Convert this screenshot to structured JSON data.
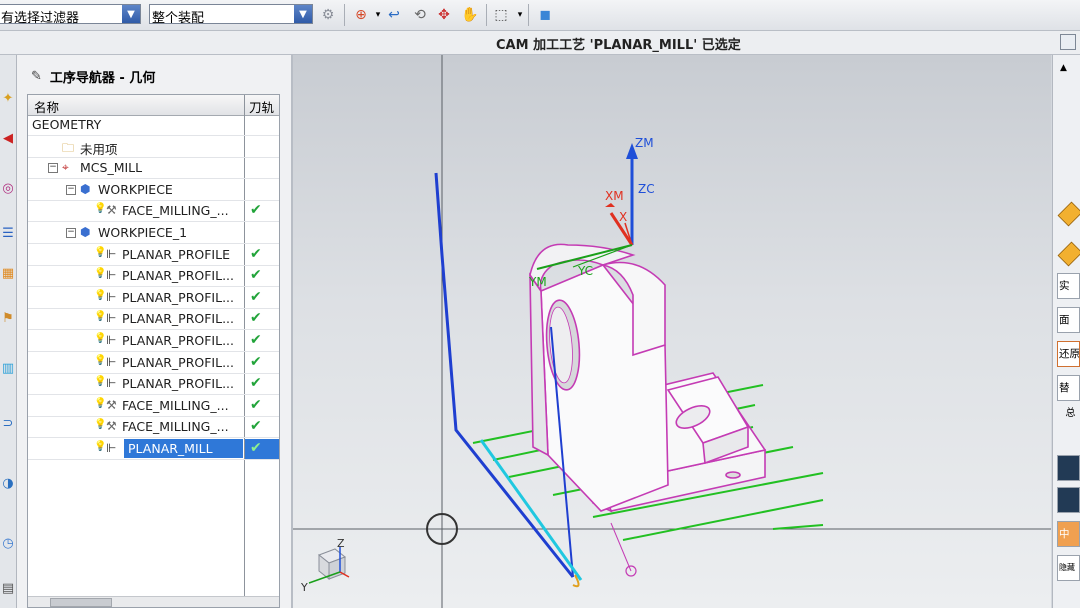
{
  "toolbar": {
    "filter_combo": "有选择过滤器",
    "scope_combo": "整个装配"
  },
  "status": {
    "message": "CAM 加工工艺 'PLANAR_MILL' 已选定"
  },
  "navigator": {
    "title": "工序导航器 - 几何",
    "col_name": "名称",
    "col_toolpath": "刀轨",
    "rows": [
      {
        "label": "GEOMETRY",
        "indent": 0,
        "icon": "",
        "check": ""
      },
      {
        "label": "未用项",
        "indent": 1,
        "icon": "folder-icon",
        "check": ""
      },
      {
        "label": "MCS_MILL",
        "indent": 1,
        "icon": "mcs-icon",
        "check": ""
      },
      {
        "label": "WORKPIECE",
        "indent": 2,
        "icon": "workpiece-icon",
        "check": ""
      },
      {
        "label": "FACE_MILLING_...",
        "indent": 3,
        "icon": "face-mill-icon",
        "check": "✔"
      },
      {
        "label": "WORKPIECE_1",
        "indent": 2,
        "icon": "workpiece-icon",
        "check": ""
      },
      {
        "label": "PLANAR_PROFILE",
        "indent": 3,
        "icon": "planar-op-icon",
        "check": "✔"
      },
      {
        "label": "PLANAR_PROFIL...",
        "indent": 3,
        "icon": "planar-op-icon",
        "check": "✔"
      },
      {
        "label": "PLANAR_PROFIL...",
        "indent": 3,
        "icon": "planar-op-icon",
        "check": "✔"
      },
      {
        "label": "PLANAR_PROFIL...",
        "indent": 3,
        "icon": "planar-op-icon",
        "check": "✔"
      },
      {
        "label": "PLANAR_PROFIL...",
        "indent": 3,
        "icon": "planar-op-icon",
        "check": "✔"
      },
      {
        "label": "PLANAR_PROFIL...",
        "indent": 3,
        "icon": "planar-op-icon",
        "check": "✔"
      },
      {
        "label": "PLANAR_PROFIL...",
        "indent": 3,
        "icon": "planar-op-icon",
        "check": "✔"
      },
      {
        "label": "FACE_MILLING_...",
        "indent": 3,
        "icon": "face-mill-icon",
        "check": "✔"
      },
      {
        "label": "FACE_MILLING_...",
        "indent": 3,
        "icon": "face-mill-icon",
        "check": "✔"
      },
      {
        "label": "PLANAR_MILL",
        "indent": 3,
        "icon": "planar-op-icon",
        "check": "✔",
        "selected": true
      }
    ]
  },
  "viewport": {
    "axis_labels": {
      "zm": "ZM",
      "zc": "ZC",
      "xm": "XM",
      "xc": "X",
      "ym": "YM",
      "yc": "YC"
    },
    "triad_labels": {
      "z": "Z",
      "y": "Y"
    }
  },
  "right_palette": {
    "buttons": [
      "实",
      "面",
      "还原",
      "替",
      "总",
      "中",
      "隐藏"
    ]
  },
  "colors": {
    "selection": "#2f78d8",
    "check": "#22a43a",
    "toolpath": "#1f3fd0",
    "part_edge": "#c43bb4",
    "path_green": "#22c022"
  }
}
